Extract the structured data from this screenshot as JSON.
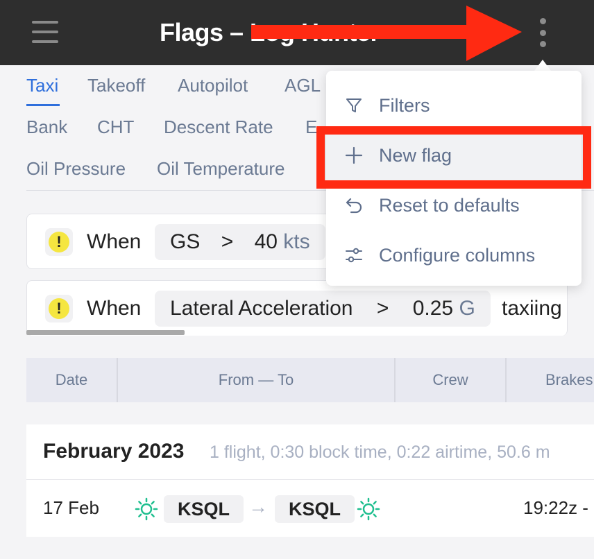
{
  "header": {
    "title": "Flags – Log Hunter",
    "chevron": "⌄"
  },
  "tabs": [
    {
      "label": "Taxi"
    },
    {
      "label": "Takeoff"
    },
    {
      "label": "Autopilot"
    },
    {
      "label": "AGL"
    },
    {
      "label": "Bank"
    },
    {
      "label": "CHT"
    },
    {
      "label": "Descent Rate"
    },
    {
      "label": "E"
    },
    {
      "label": "Oil Pressure"
    },
    {
      "label": "Oil Temperature"
    }
  ],
  "rules": [
    {
      "when": "When",
      "param": "GS",
      "op": ">",
      "value": "40",
      "unit": "kts",
      "tail": ""
    },
    {
      "when": "When",
      "param": "Lateral Acceleration",
      "op": ">",
      "value": "0.25",
      "unit": "G",
      "tail": "taxiing"
    }
  ],
  "table": {
    "columns": [
      "Date",
      "From — To",
      "Crew",
      "Brakes"
    ]
  },
  "month": {
    "title": "February 2023",
    "stats": "1 flight, 0:30 block time, 0:22 airtime, 50.6 m",
    "flights": [
      {
        "date": "17 Feb",
        "from": "KSQL",
        "arrow": "→",
        "to": "KSQL",
        "time": "19:22z -"
      }
    ]
  },
  "menu": {
    "items": [
      {
        "label": "Filters",
        "icon": "filter-icon"
      },
      {
        "label": "New flag",
        "icon": "plus-icon"
      },
      {
        "label": "Reset to defaults",
        "icon": "undo-icon"
      },
      {
        "label": "Configure columns",
        "icon": "sliders-icon"
      }
    ]
  },
  "colors": {
    "accent": "#2f6fdc",
    "topbar": "#2e2e2e",
    "annotation": "#ff2a12",
    "warning": "#f5e640",
    "sun": "#1fbf8f"
  }
}
